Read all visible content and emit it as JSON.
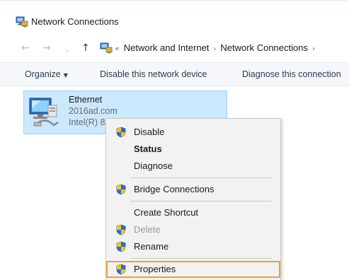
{
  "window": {
    "title": "Network Connections",
    "icon": "network-connections-icon"
  },
  "address_bar": {
    "back_glyph": "←",
    "forward_glyph": "→",
    "dropdown_glyph": "⌄",
    "up_glyph": "↑",
    "overflow_glyph": "«",
    "separator_glyph": "›",
    "crumbs": [
      "Network and Internet",
      "Network Connections"
    ]
  },
  "command_bar": {
    "organize_label": "Organize",
    "organize_caret": "▼",
    "disable_label": "Disable this network device",
    "diagnose_label": "Diagnose this connection"
  },
  "connection": {
    "name": "Ethernet",
    "domain": "2016ad.com",
    "adapter": "Intel(R) 8"
  },
  "context_menu": {
    "items": [
      {
        "label": "Disable",
        "shield": true,
        "bold": false,
        "disabled": false
      },
      {
        "label": "Status",
        "shield": false,
        "bold": true,
        "disabled": false
      },
      {
        "label": "Diagnose",
        "shield": false,
        "bold": false,
        "disabled": false
      },
      {
        "label": "Bridge Connections",
        "shield": true,
        "bold": false,
        "disabled": false
      },
      {
        "label": "Create Shortcut",
        "shield": false,
        "bold": false,
        "disabled": false
      },
      {
        "label": "Delete",
        "shield": true,
        "bold": false,
        "disabled": true
      },
      {
        "label": "Rename",
        "shield": true,
        "bold": false,
        "disabled": false
      },
      {
        "label": "Properties",
        "shield": true,
        "bold": false,
        "disabled": false,
        "highlighted": true
      }
    ]
  },
  "colors": {
    "selection_fill": "#cce8ff",
    "selection_border": "#99d1ff",
    "menu_background": "#f2f2f2",
    "highlight_border": "#e8a23a",
    "shield_blue": "#2a6fd6",
    "shield_yellow": "#f5c518"
  }
}
